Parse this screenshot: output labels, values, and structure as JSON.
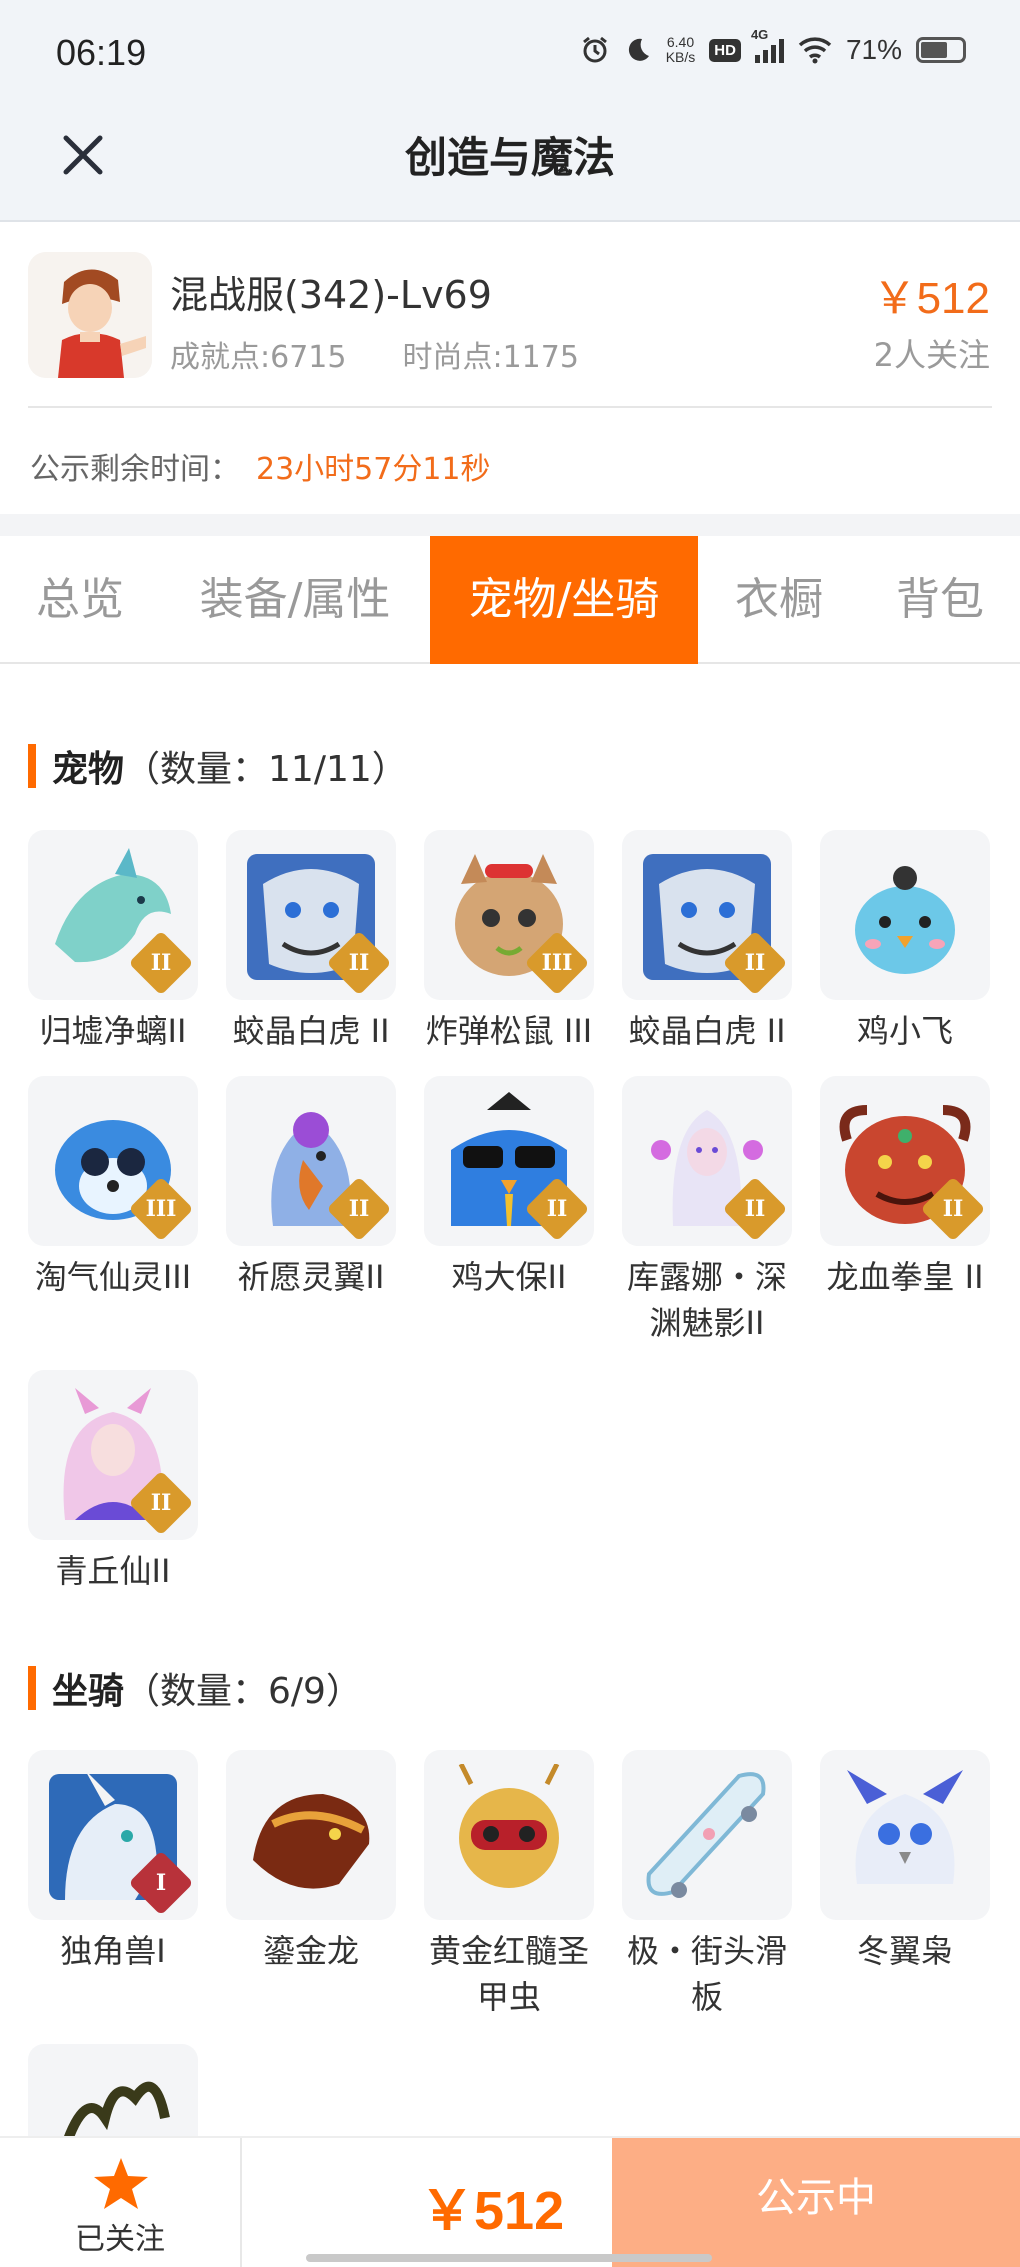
{
  "status_bar": {
    "time": "06:19",
    "net_speed": "6.40",
    "net_unit": "KB/s",
    "hd": "HD",
    "network": "4G",
    "battery": "71%"
  },
  "nav": {
    "title": "创造与魔法"
  },
  "character": {
    "name": "混战服(342)-Lv69",
    "achievement": "成就点:6715",
    "fashion": "时尚点:1175",
    "price": "￥512",
    "followers": "2人关注"
  },
  "notice": {
    "label": "公示剩余时间：",
    "time": "23小时57分11秒"
  },
  "tabs": [
    {
      "label": "总览",
      "active": false
    },
    {
      "label": "装备/属性",
      "active": false
    },
    {
      "label": "宠物/坐骑",
      "active": true
    },
    {
      "label": "衣橱",
      "active": false
    },
    {
      "label": "背包",
      "active": false
    }
  ],
  "pets": {
    "title": "宠物",
    "count": "（数量：11/11）",
    "items": [
      {
        "name": "归墟净螭II",
        "tier": "II"
      },
      {
        "name": "蛟晶白虎 II",
        "tier": "II"
      },
      {
        "name": "炸弹松鼠 III",
        "tier": "III"
      },
      {
        "name": "蛟晶白虎 II",
        "tier": "II"
      },
      {
        "name": "鸡小飞",
        "tier": ""
      },
      {
        "name": "淘气仙灵III",
        "tier": "III"
      },
      {
        "name": "祈愿灵翼II",
        "tier": "II"
      },
      {
        "name": "鸡大保II",
        "tier": "II"
      },
      {
        "name": "库露娜・深渊魅影II",
        "tier": "II"
      },
      {
        "name": "龙血拳皇 II",
        "tier": "II"
      },
      {
        "name": "青丘仙II",
        "tier": "II"
      }
    ]
  },
  "mounts": {
    "title": "坐骑",
    "count": "（数量：6/9）",
    "items": [
      {
        "name": "独角兽I",
        "tier": "I"
      },
      {
        "name": "鎏金龙",
        "tier": ""
      },
      {
        "name": "黄金红髓圣甲虫",
        "tier": ""
      },
      {
        "name": "极・街头滑板",
        "tier": ""
      },
      {
        "name": "冬翼枭",
        "tier": ""
      },
      {
        "name": "",
        "tier": ""
      }
    ]
  },
  "bottom": {
    "follow_label": "已关注",
    "price": "￥512",
    "status_label": "公示中"
  },
  "colors": {
    "accent": "#ff6a00",
    "price": "#f26c1a",
    "badge_gold": "#d99a2b",
    "badge_red": "#b8323a",
    "status_btn": "#fdae85"
  }
}
